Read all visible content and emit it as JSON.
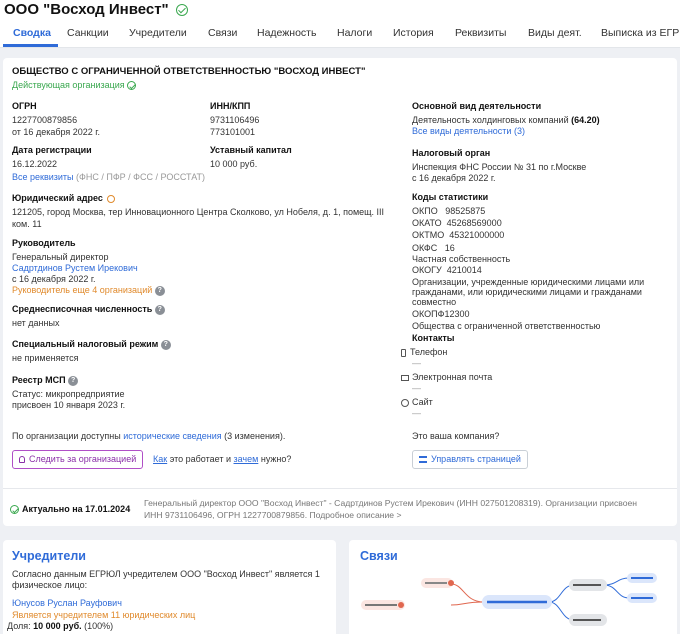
{
  "header": {
    "company_name": "ООО \"Восход Инвест\""
  },
  "tabs": [
    {
      "label": "Сводка"
    },
    {
      "label": "Санкции"
    },
    {
      "label": "Учредители"
    },
    {
      "label": "Связи"
    },
    {
      "label": "Надежность"
    },
    {
      "label": "Налоги"
    },
    {
      "label": "История"
    },
    {
      "label": "Реквизиты"
    },
    {
      "label": "Виды деят."
    },
    {
      "label": "Выписка из ЕГР"
    }
  ],
  "summary": {
    "full_name": "ОБЩЕСТВО С ОГРАНИЧЕННОЙ ОТВЕТСТВЕННОСТЬЮ \"ВОСХОД ИНВЕСТ\"",
    "status": "Действующая организация",
    "ogrn_label": "ОГРН",
    "ogrn": "1227700879856",
    "ogrn_date": "от 16 декабря 2022 г.",
    "inn_label": "ИНН/КПП",
    "inn": "9731106496",
    "kpp": "773101001",
    "reg_label": "Дата регистрации",
    "reg_date": "16.12.2022",
    "capital_label": "Уставный капитал",
    "capital": "10 000 руб.",
    "all_req_link": "Все реквизиты",
    "all_req_note": "(ФНС / ПФР / ФСС / РОССТАТ)",
    "address_label": "Юридический адрес",
    "address_line1": "121205, город Москва, тер Инновационного Центра Сколково, ул Нобеля, д. 1, помещ. III",
    "address_line2": "ком. 11",
    "head_label": "Руководитель",
    "head_position": "Генеральный директор",
    "head_name": "Садртдинов Рустем Ирекович",
    "head_since": "с 16 декабря 2022 г.",
    "head_more": "Руководитель еще 4 организаций",
    "employees_label": "Среднесписочная численность",
    "employees_value": "нет данных",
    "tax_regime_label": "Специальный налоговый режим",
    "tax_regime_value": "не применяется",
    "msp_label": "Реестр МСП",
    "msp_status": "Статус: микропредприятие",
    "msp_date": "присвоен 10 января 2023 г.",
    "activity_label": "Основной вид деятельности",
    "activity_value": "Деятельность холдинговых компаний",
    "activity_code": "(64.20)",
    "activity_all_link": "Все виды деятельности (3)",
    "tax_authority_label": "Налоговый орган",
    "tax_authority_value": "Инспекция ФНС России № 31 по г.Москве",
    "tax_authority_date": "с 16 декабря 2022 г.",
    "stats_label": "Коды статистики",
    "okpo": "ОКПО   98525875",
    "okato": "ОКАТО  45268569000",
    "oktmo": "ОКТМО  45321000000",
    "okfs": "ОКФС   16",
    "okfs_desc": "Частная собственность",
    "okogu": "ОКОГУ  4210014",
    "okogu_desc1": "Организации, учрежденные юридическими лицами или",
    "okogu_desc2": "гражданами, или юридическими лицами и гражданами",
    "okogu_desc3": "совместно",
    "okopf": "ОКОПФ12300",
    "okopf_desc": "Общества с ограниченной ответственностью",
    "contacts_label": "Контакты",
    "phone_label": "Телефон",
    "email_label": "Электронная почта",
    "site_label": "Сайт",
    "history_pre": "По организации доступны",
    "history_link": "исторические сведения",
    "history_post": "(3 изменения).",
    "follow_button": "Следить за организацией",
    "how_link": "Как",
    "how_mid": "это работает и",
    "why_link": "зачем",
    "why_post": "нужно?",
    "your_company": "Это ваша компания?",
    "manage_button": "Управлять страницей",
    "actual": "Актуально на 17.01.2024",
    "footer_line1": "Генеральный директор ООО \"Восход Инвест\" - Садртдинов Рустем Ирекович (ИНН 027501208319). Организации присвоен",
    "footer_line2": "ИНН 9731106496, ОГРН 1227700879856. Подробное описание >"
  },
  "founders": {
    "title": "Учредители",
    "desc1": "Согласно данным ЕГРЮЛ учредителем ООО \"Восход Инвест\" является 1",
    "desc2": "физическое лицо:",
    "name": "Юнусов Руслан Рауфович",
    "note": "Является учредителем 11 юридических лиц",
    "share_label": "Доля:",
    "share_value": "10 000 руб.",
    "share_pct": "(100%)"
  },
  "links": {
    "title": "Связи"
  },
  "colors": {
    "accent": "#2f6bd8",
    "ok": "#3aa84f",
    "warn": "#e08a2c",
    "node_red": "#e0674f"
  }
}
